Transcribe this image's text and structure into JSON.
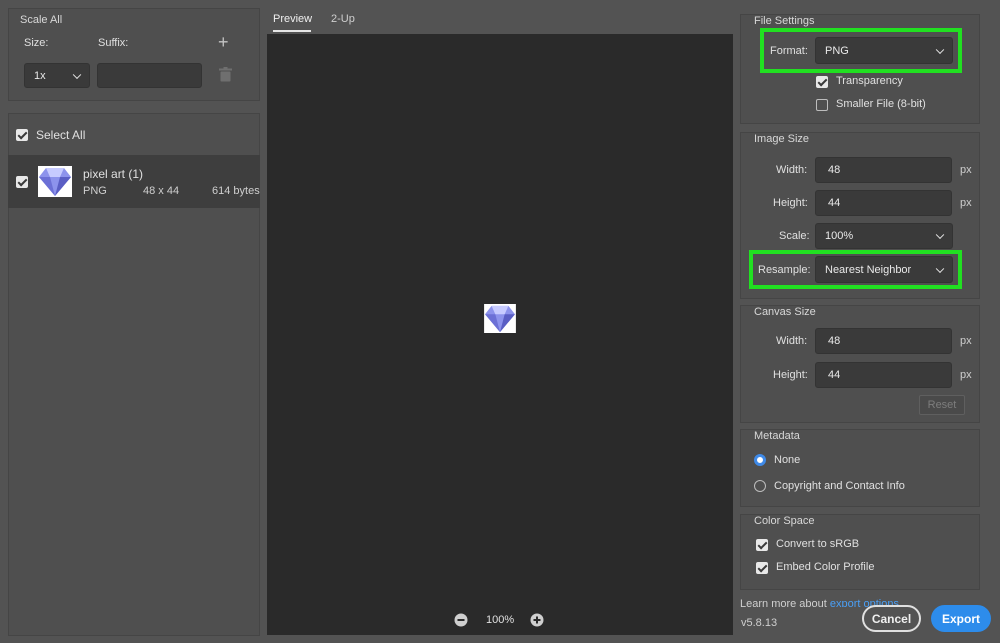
{
  "scale_all": {
    "title": "Scale All",
    "size_label": "Size:",
    "suffix_label": "Suffix:",
    "size_value": "1x",
    "suffix_value": ""
  },
  "assets": {
    "select_all_label": "Select All",
    "items": [
      {
        "name": "pixel art (1)",
        "format": "PNG",
        "dimensions": "48 x 44",
        "size": "614 bytes"
      }
    ]
  },
  "preview": {
    "tabs": [
      "Preview",
      "2-Up"
    ],
    "active_tab": "Preview",
    "zoom": "100%"
  },
  "file_settings": {
    "title": "File Settings",
    "format_label": "Format:",
    "format_value": "PNG",
    "transparency_label": "Transparency",
    "smaller_file_label": "Smaller File (8-bit)"
  },
  "image_size": {
    "title": "Image Size",
    "width_label": "Width:",
    "width_value": "48",
    "height_label": "Height:",
    "height_value": "44",
    "unit": "px",
    "scale_label": "Scale:",
    "scale_value": "100%",
    "resample_label": "Resample:",
    "resample_value": "Nearest Neighbor"
  },
  "canvas_size": {
    "title": "Canvas Size",
    "width_label": "Width:",
    "width_value": "48",
    "height_label": "Height:",
    "height_value": "44",
    "unit": "px",
    "reset_label": "Reset"
  },
  "metadata": {
    "title": "Metadata",
    "options": [
      "None",
      "Copyright and Contact Info"
    ],
    "selected": "None"
  },
  "color_space": {
    "title": "Color Space",
    "convert_label": "Convert to sRGB",
    "embed_label": "Embed Color Profile"
  },
  "footer": {
    "learn_more_prefix": "Learn more about ",
    "learn_more_link": "export options",
    "version": "v5.8.13",
    "cancel_label": "Cancel",
    "export_label": "Export"
  },
  "colors": {
    "highlight": "#21e021",
    "accent": "#2d8ceb",
    "preview_bg": "#2a2a2a"
  }
}
